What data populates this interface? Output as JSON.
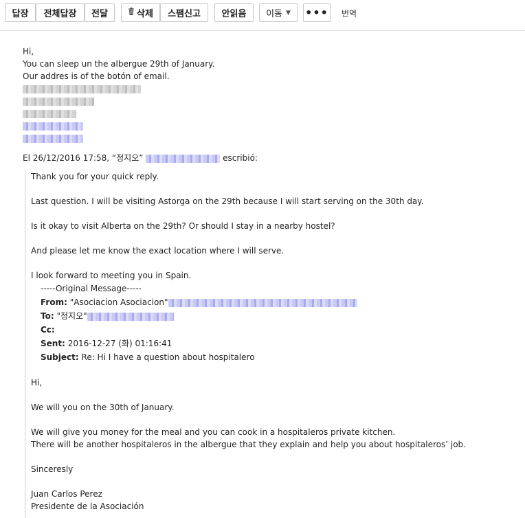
{
  "toolbar": {
    "reply": "답장",
    "reply_all": "전체답장",
    "forward": "전달",
    "delete": "삭제",
    "spam": "스팸신고",
    "unread": "안읽음",
    "move": "이동",
    "more": "•••",
    "translate": "번역"
  },
  "reply_text": {
    "greeting": "Hi,",
    "line1": "You can sleep un the albergue 29th of January.",
    "line2": "Our addres is of the botón of email."
  },
  "quote_intro": {
    "prefix": "El 26/12/2016 17:58, “정지오”",
    "suffix": "escribió:"
  },
  "quoted": {
    "p1": "Thank you for your quick reply.",
    "p2": "Last question. I will be visiting Astorga on the 29th because I will start serving on the 30th day.",
    "p3": "Is it okay to visit Alberta on the 29th? Or should I stay in a nearby hostel?",
    "p4": "And please let me know the exact location where I will serve.",
    "p5": "I look forward to meeting you in Spain."
  },
  "original": {
    "separator": "-----Original Message-----",
    "from_label": "From:",
    "from_value": "\"Asociacion Asociacion\"",
    "to_label": "To:",
    "to_value": "\"정지오\"",
    "cc_label": "Cc:",
    "sent_label": "Sent:",
    "sent_value": "2016-12-27 (화) 01:16:41",
    "subject_label": "Subject:",
    "subject_value": "Re: Hi I have a question about hospitalero"
  },
  "original_body": {
    "greeting": "Hi,",
    "l1": "We will you on the 30th of January.",
    "l2": "We will give you money for the meal and you can cook in a hospitaleros private kitchen.",
    "l3": "There will be another hospitaleros in the albergue that they explain and help you about hospitaleros’ job.",
    "closing": "Sinceresly",
    "name": "Juan Carlos Perez",
    "title": "Presidente de la Asociación"
  }
}
